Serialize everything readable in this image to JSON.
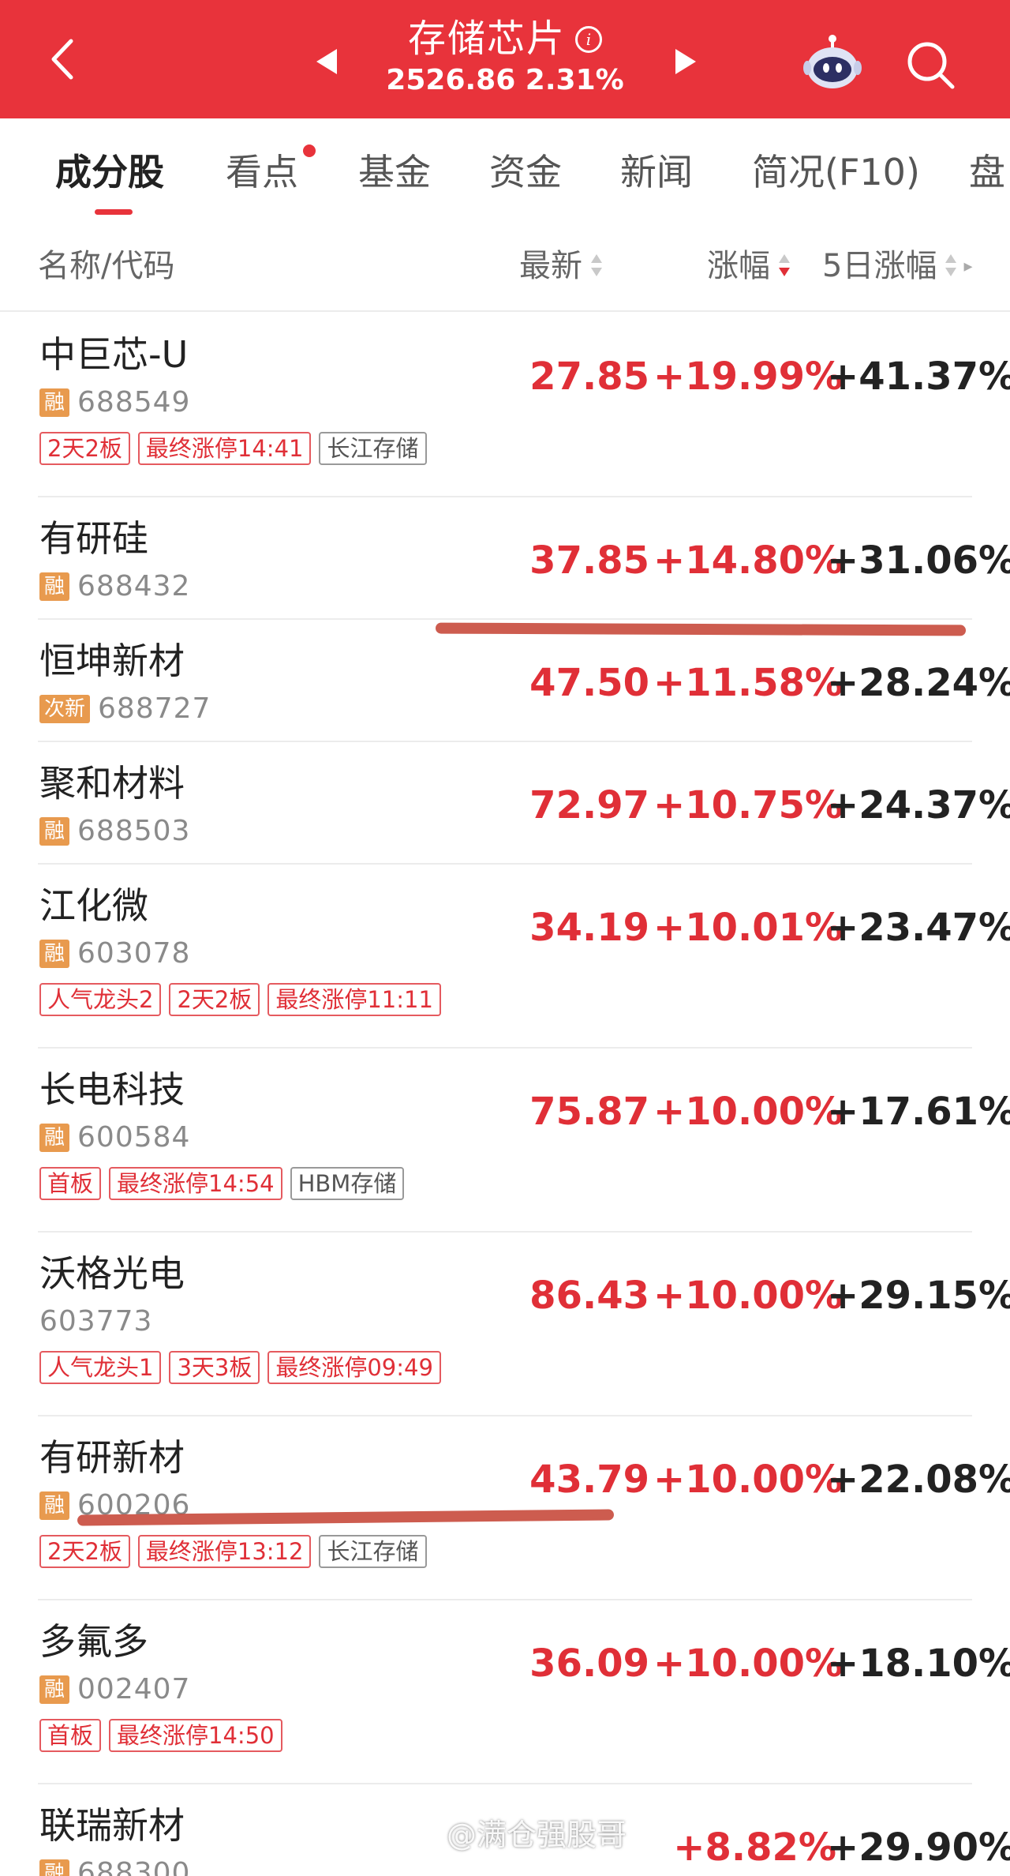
{
  "header": {
    "title": "存储芯片",
    "info_glyph": "i",
    "subtitle": "2526.86 2.31%",
    "bg_color": "#e8333b"
  },
  "tabs": [
    {
      "label": "成分股",
      "active": true
    },
    {
      "label": "看点",
      "has_dot": true
    },
    {
      "label": "基金"
    },
    {
      "label": "资金"
    },
    {
      "label": "新闻"
    },
    {
      "label": "简况(F10)"
    },
    {
      "label": "盘"
    }
  ],
  "columns": {
    "name_code": "名称/代码",
    "latest": "最新",
    "change": "涨幅",
    "change_5d": "5日涨幅"
  },
  "colors": {
    "up_red": "#e02f37",
    "badge_orange": "#e89a4e",
    "annotation_stroke": "#c84a3c"
  },
  "stocks": [
    {
      "name": "中巨芯-U",
      "badge": "融",
      "code": "688549",
      "price": "27.85",
      "change": "+19.99%",
      "change_5d": "+41.37%",
      "tags": [
        {
          "text": "2天2板",
          "style": "red"
        },
        {
          "text": "最终涨停14:41",
          "style": "red"
        },
        {
          "text": "长江存储",
          "style": "grey"
        }
      ]
    },
    {
      "name": "有研硅",
      "badge": "融",
      "code": "688432",
      "price": "37.85",
      "change": "+14.80%",
      "change_5d": "+31.06%",
      "tags": []
    },
    {
      "name": "恒坤新材",
      "badge": "次新",
      "code": "688727",
      "price": "47.50",
      "change": "+11.58%",
      "change_5d": "+28.24%",
      "tags": []
    },
    {
      "name": "聚和材料",
      "badge": "融",
      "code": "688503",
      "price": "72.97",
      "change": "+10.75%",
      "change_5d": "+24.37%",
      "tags": []
    },
    {
      "name": "江化微",
      "badge": "融",
      "code": "603078",
      "price": "34.19",
      "change": "+10.01%",
      "change_5d": "+23.47%",
      "tags": [
        {
          "text": "人气龙头2",
          "style": "red"
        },
        {
          "text": "2天2板",
          "style": "red"
        },
        {
          "text": "最终涨停11:11",
          "style": "red"
        }
      ]
    },
    {
      "name": "长电科技",
      "badge": "融",
      "code": "600584",
      "price": "75.87",
      "change": "+10.00%",
      "change_5d": "+17.61%",
      "tags": [
        {
          "text": "首板",
          "style": "red"
        },
        {
          "text": "最终涨停14:54",
          "style": "red"
        },
        {
          "text": "HBM存储",
          "style": "grey"
        }
      ]
    },
    {
      "name": "沃格光电",
      "badge": "",
      "code": "603773",
      "price": "86.43",
      "change": "+10.00%",
      "change_5d": "+29.15%",
      "tags": [
        {
          "text": "人气龙头1",
          "style": "red"
        },
        {
          "text": "3天3板",
          "style": "red"
        },
        {
          "text": "最终涨停09:49",
          "style": "red"
        }
      ]
    },
    {
      "name": "有研新材",
      "badge": "融",
      "code": "600206",
      "price": "43.79",
      "change": "+10.00%",
      "change_5d": "+22.08%",
      "tags": [
        {
          "text": "2天2板",
          "style": "red"
        },
        {
          "text": "最终涨停13:12",
          "style": "red"
        },
        {
          "text": "长江存储",
          "style": "grey"
        }
      ]
    },
    {
      "name": "多氟多",
      "badge": "融",
      "code": "002407",
      "price": "36.09",
      "change": "+10.00%",
      "change_5d": "+18.10%",
      "tags": [
        {
          "text": "首板",
          "style": "red"
        },
        {
          "text": "最终涨停14:50",
          "style": "red"
        }
      ]
    },
    {
      "name": "联瑞新材",
      "badge": "融",
      "code": "688300",
      "price": "",
      "change": "+8.82%",
      "change_5d": "+29.90%",
      "tags": []
    }
  ],
  "watermark": "@满仓强股哥"
}
